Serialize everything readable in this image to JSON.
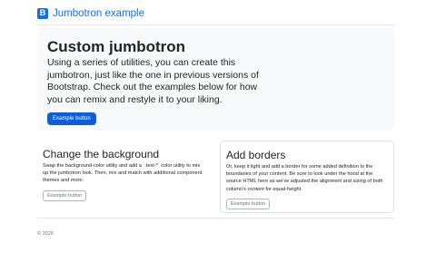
{
  "header": {
    "logo_glyph": "B",
    "brand_text": "Jumbotron example"
  },
  "jumbotron": {
    "title": "Custom jumbotron",
    "lead": "Using a series of utilities, you can create this jumbotron, just like the one in previous versions of Bootstrap. Check out the examples below for how you can remix and restyle it to your liking.",
    "button_label": "Example button"
  },
  "cards": [
    {
      "title": "Change the background",
      "text": "Swap the background-color utility and add a `.text-*` color utility to mix up the jumbotron look. Then, mix and match with additional component themes and more.",
      "button_label": "Example button"
    },
    {
      "title": "Add borders",
      "text": "Or, keep it light and add a border for some added definition to the boundaries of your content. Be sure to look under the hood at the source HTML here as we've adjusted the alignment and sizing of both column's content for equal-height.",
      "button_label": "Example button"
    }
  ],
  "footer": {
    "copyright": "© 2026"
  },
  "colors": {
    "primary": "#0d6efd",
    "light_bg": "#f8f9fa",
    "border": "#dee2e6",
    "muted": "#6c757d"
  }
}
